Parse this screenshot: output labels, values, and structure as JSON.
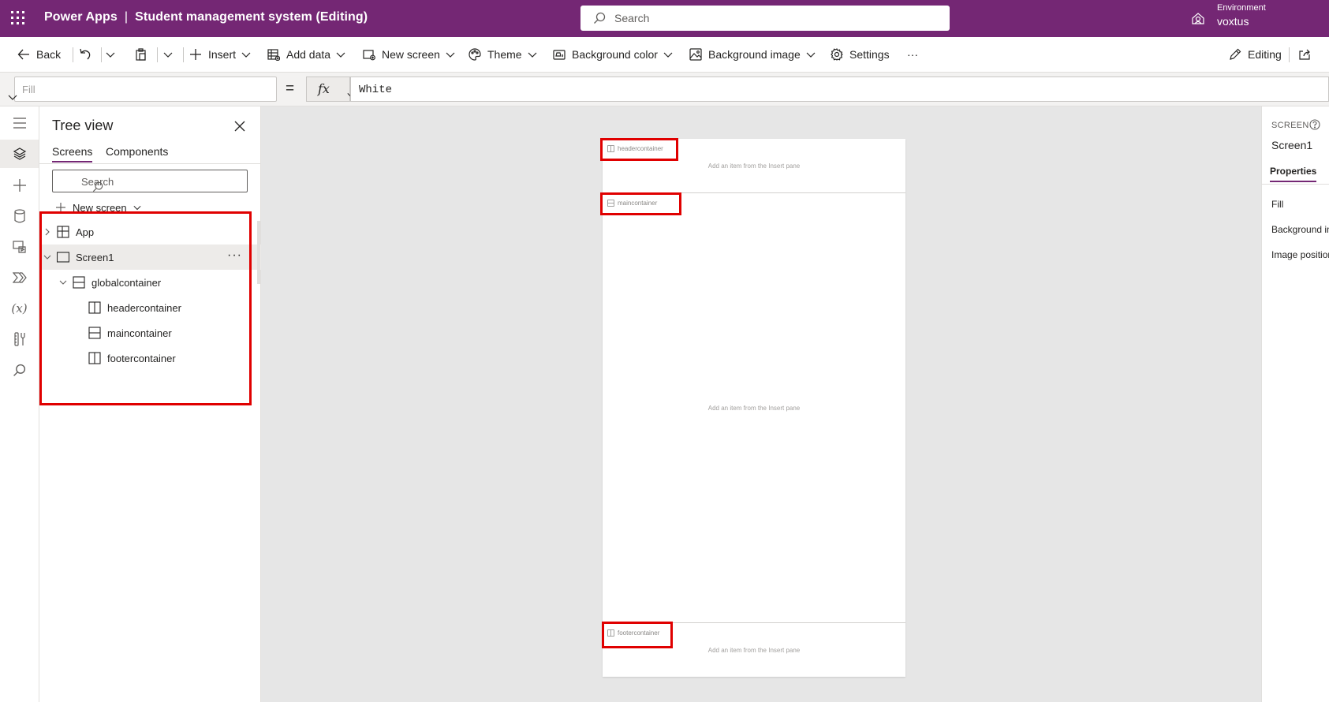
{
  "titlebar": {
    "product": "Power Apps",
    "separator": "|",
    "app_name": "Student management system (Editing)",
    "search_placeholder": "Search",
    "environment_label": "Environment",
    "environment_value": "voxtus"
  },
  "commandbar": {
    "back": "Back",
    "insert": "Insert",
    "add_data": "Add data",
    "new_screen": "New screen",
    "theme": "Theme",
    "background_color": "Background color",
    "background_image": "Background image",
    "settings": "Settings",
    "more": "···",
    "editing": "Editing"
  },
  "formulabar": {
    "property": "Fill",
    "equals": "=",
    "fx": "fx",
    "formula": "White"
  },
  "treeview": {
    "title": "Tree view",
    "tabs": [
      "Screens",
      "Components"
    ],
    "search_placeholder": "Search",
    "new_screen": "New screen",
    "items": [
      {
        "label": "App",
        "level": 0,
        "icon": "app-icon"
      },
      {
        "label": "Screen1",
        "level": 0,
        "icon": "screen-icon",
        "selected": true
      },
      {
        "label": "globalcontainer",
        "level": 1,
        "icon": "vertical-container-icon"
      },
      {
        "label": "headercontainer",
        "level": 2,
        "icon": "horizontal-container-icon"
      },
      {
        "label": "maincontainer",
        "level": 2,
        "icon": "vertical-container-icon"
      },
      {
        "label": "footercontainer",
        "level": 2,
        "icon": "horizontal-container-icon"
      }
    ],
    "more": "···"
  },
  "canvas": {
    "header_tag": "headercontainer",
    "main_tag": "maincontainer",
    "footer_tag": "footercontainer",
    "hint": "Add an item from the Insert pane"
  },
  "properties": {
    "type": "SCREEN",
    "name": "Screen1",
    "tab": "Properties",
    "items": [
      "Fill",
      "Background image",
      "Image position"
    ]
  },
  "colors": {
    "brand": "#742774",
    "annotation": "#e00000"
  }
}
